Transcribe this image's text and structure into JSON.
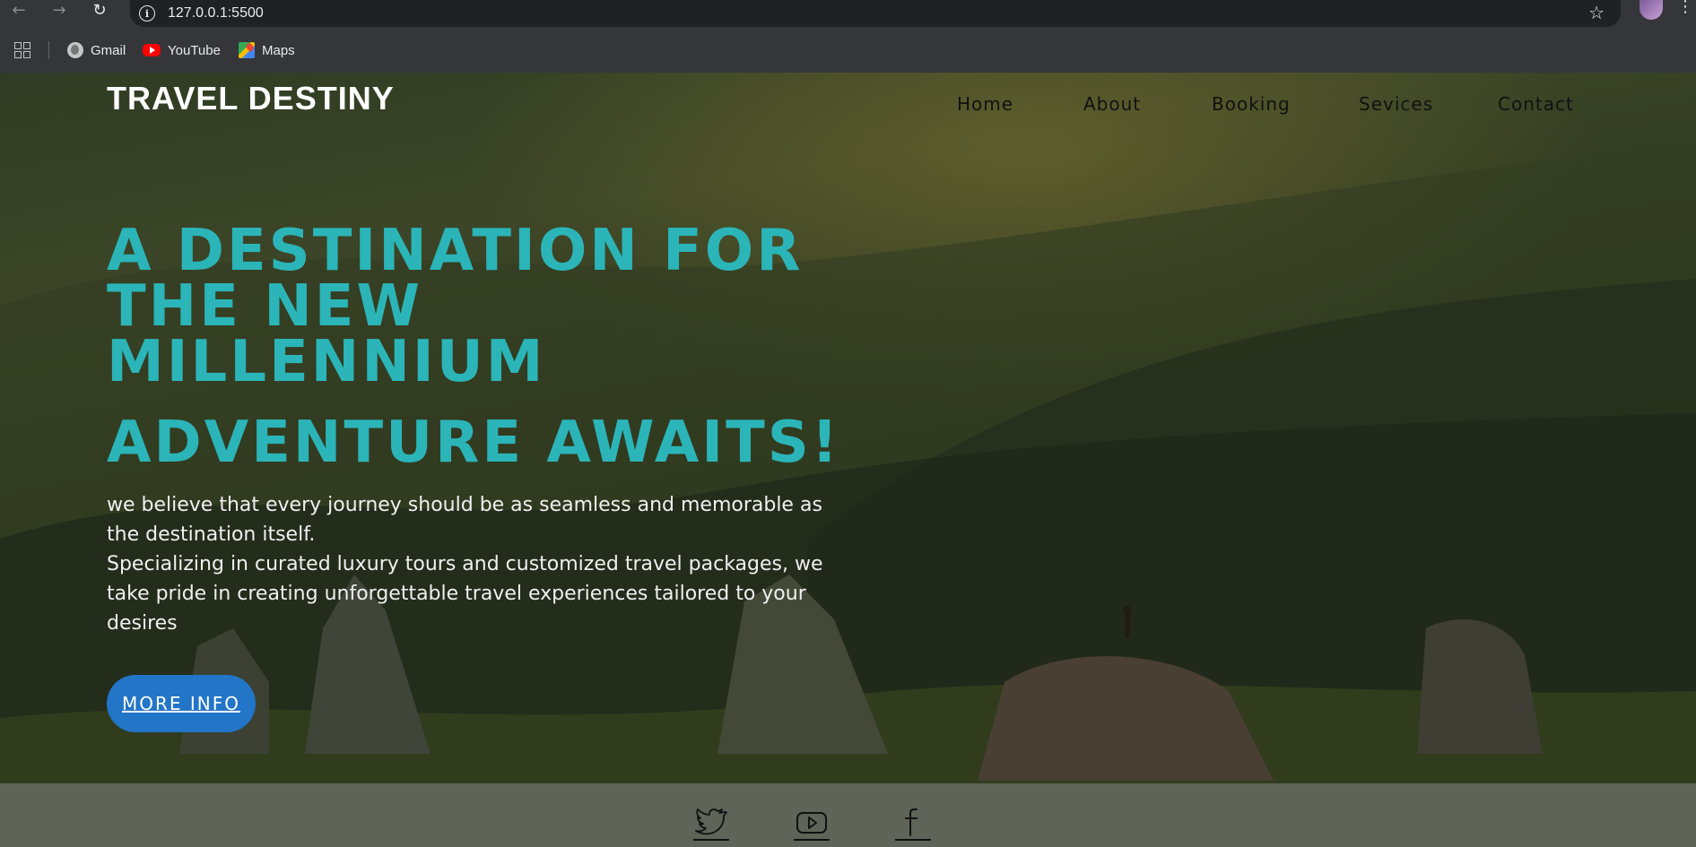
{
  "browser": {
    "url": "127.0.0.1:5500",
    "bookmarks": [
      {
        "label": "Gmail",
        "icon": "globe-icon"
      },
      {
        "label": "YouTube",
        "icon": "youtube-icon"
      },
      {
        "label": "Maps",
        "icon": "maps-icon"
      }
    ]
  },
  "site": {
    "brand": "TRAVEL DESTINY",
    "nav": [
      "Home",
      "About",
      "Booking",
      "Sevices",
      "Contact"
    ]
  },
  "hero": {
    "title": "A DESTINATION FOR THE NEW MILLENNIUM",
    "subtitle": "ADVENTURE AWAITS!",
    "paragraph_1": "we believe that every journey should be as seamless and memorable as the destination itself.",
    "paragraph_2": "Specializing in curated luxury tours and customized travel packages, we take pride in creating unforgettable travel experiences tailored to your desires",
    "button": "MORE INFO"
  },
  "footer": {
    "social": [
      "twitter-icon",
      "youtube-icon",
      "facebook-icon"
    ]
  },
  "colors": {
    "accent": "#2bb5b8",
    "button": "#2275c7",
    "footer": "#7d7d7d",
    "browser_chrome": "#35363a"
  }
}
